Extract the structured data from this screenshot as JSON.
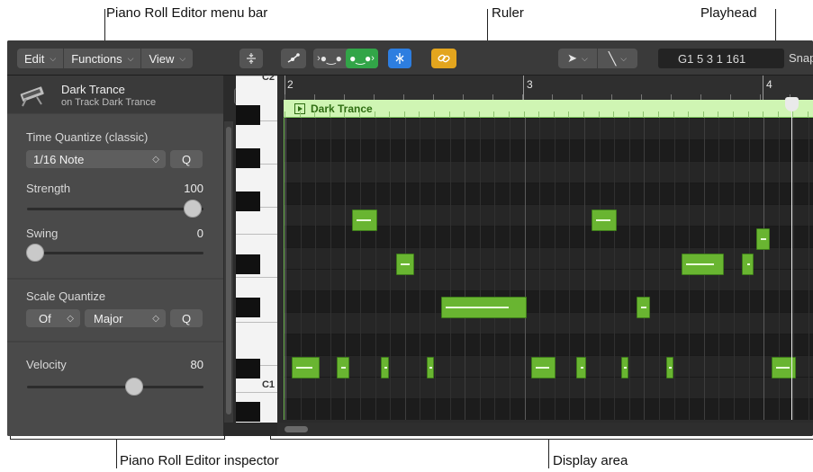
{
  "callouts": {
    "menu_bar": "Piano Roll Editor menu bar",
    "ruler": "Ruler",
    "playhead": "Playhead",
    "inspector": "Piano Roll Editor inspector",
    "display_area": "Display area"
  },
  "toolbar": {
    "menus": [
      "Edit",
      "Functions",
      "View"
    ],
    "lcd": "G1  5 3 1 161",
    "snap": "Snap"
  },
  "inspector": {
    "region_name": "Dark Trance",
    "track_name": "on Track Dark Trance",
    "time_quantize_label": "Time Quantize (classic)",
    "time_quantize_value": "1/16 Note",
    "q_label": "Q",
    "strength_label": "Strength",
    "strength_value": "100",
    "strength_fraction": 1.0,
    "swing_label": "Swing",
    "swing_value": "0",
    "swing_fraction": 0.0,
    "scale_quantize_label": "Scale Quantize",
    "scale_root": "Of",
    "scale_type": "Major",
    "velocity_label": "Velocity",
    "velocity_value": "80",
    "velocity_fraction": 0.63
  },
  "keyboard": {
    "c2": "C2",
    "c1": "C1"
  },
  "ruler": {
    "bars": [
      "2",
      "3",
      "4"
    ]
  },
  "region": {
    "name": "Dark Trance"
  },
  "colors": {
    "note": "#69b531",
    "region_header": "#cff5b3",
    "accent_blue": "#2d7ee0",
    "accent_green": "#32a548",
    "accent_yellow": "#e3a51e"
  }
}
